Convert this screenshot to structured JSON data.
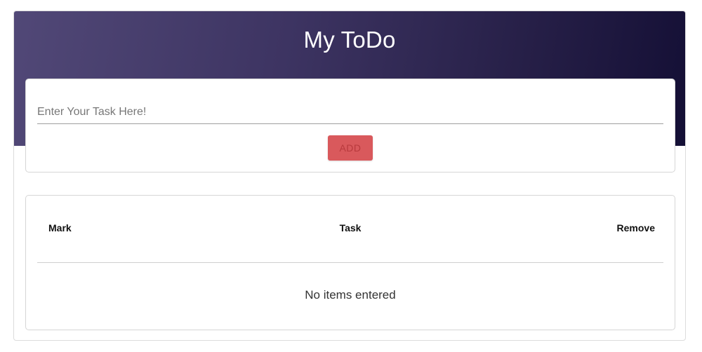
{
  "header": {
    "title": "My ToDo"
  },
  "task_form": {
    "input_placeholder": "Enter Your Task Here!",
    "input_value": "",
    "add_label": "ADD"
  },
  "task_table": {
    "columns": {
      "mark": "Mark",
      "task": "Task",
      "remove": "Remove"
    },
    "empty_message": "No items entered",
    "rows": []
  },
  "colors": {
    "header_gradient_start": "#514877",
    "header_gradient_end": "#140f35",
    "add_button": "#d9595c"
  }
}
